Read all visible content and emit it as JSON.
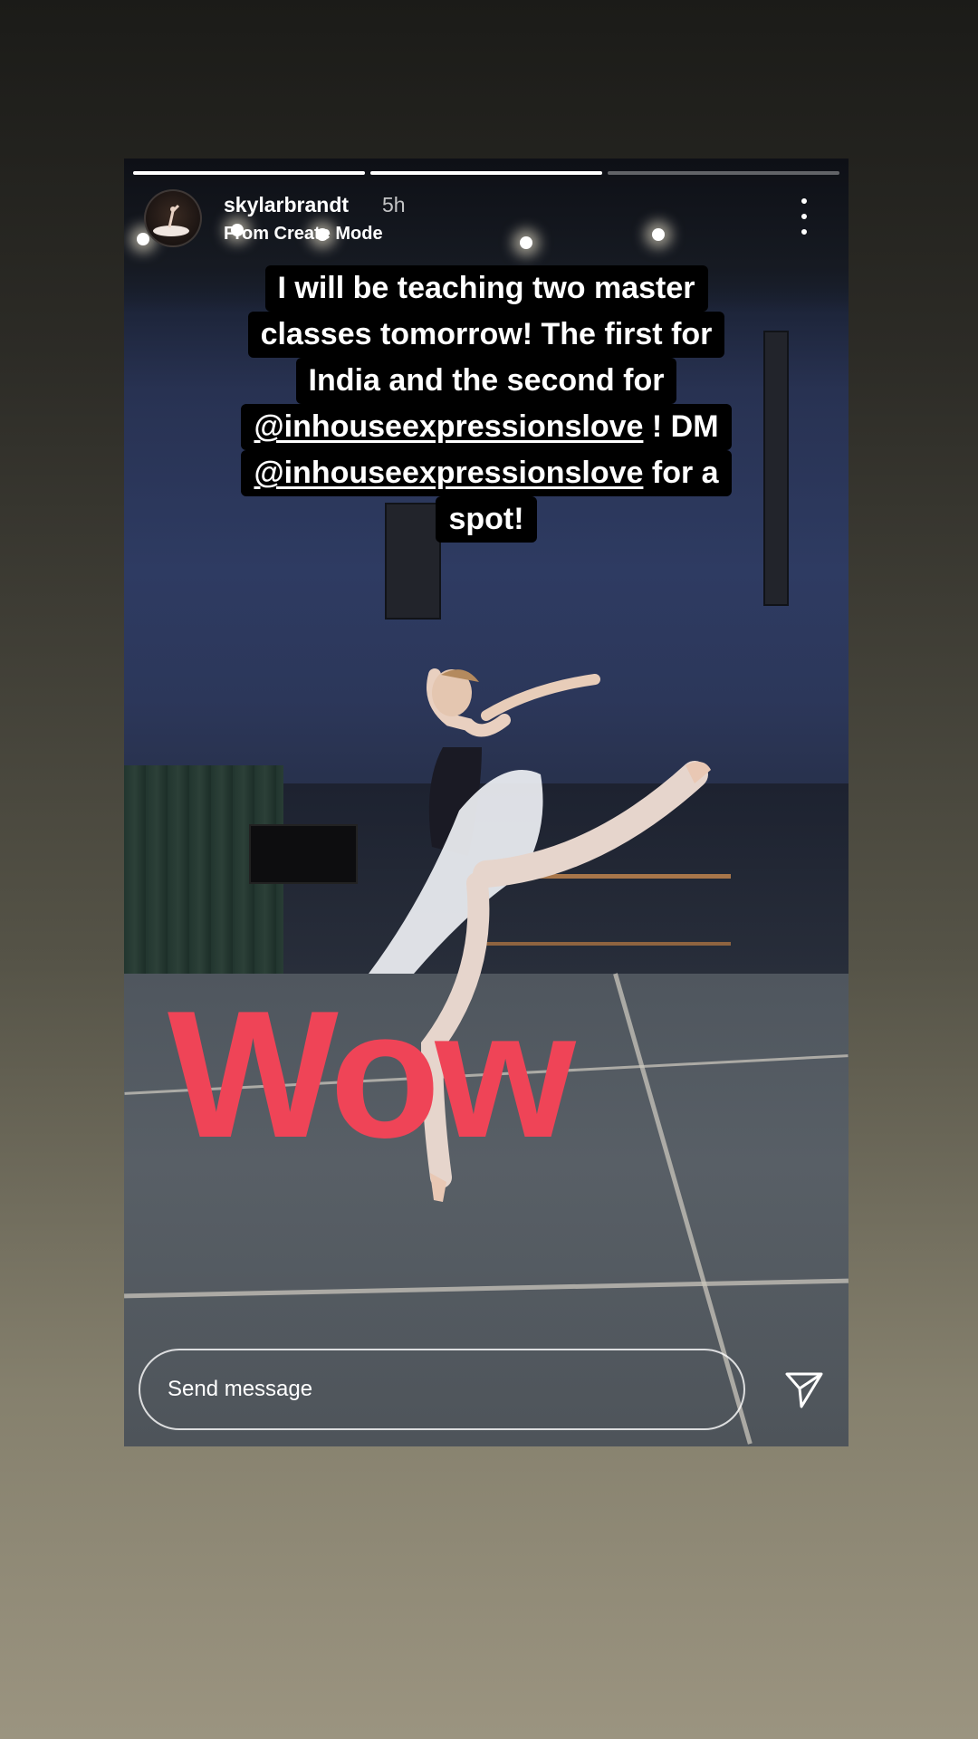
{
  "story": {
    "username": "skylarbrandt",
    "time_ago": "5h",
    "subtitle": "From Create Mode",
    "progress": [
      1.0,
      1.0,
      0.0
    ],
    "caption": {
      "line1": "I will be teaching two master",
      "line2": "classes tomorrow! The first for",
      "line3": "India and the second for",
      "line4_mention": "@inhouseexpressionslove",
      "line4_rest": " ! DM",
      "line5_mention": "@inhouseexpressionslove",
      "line5_rest": " for a",
      "line6": "spot!"
    },
    "sticker_text": "Wow",
    "sticker_color": "#ef4457"
  },
  "composer": {
    "placeholder": "Send message"
  },
  "icons": {
    "more": "more-vertical-icon",
    "send": "send-paper-plane-icon"
  }
}
